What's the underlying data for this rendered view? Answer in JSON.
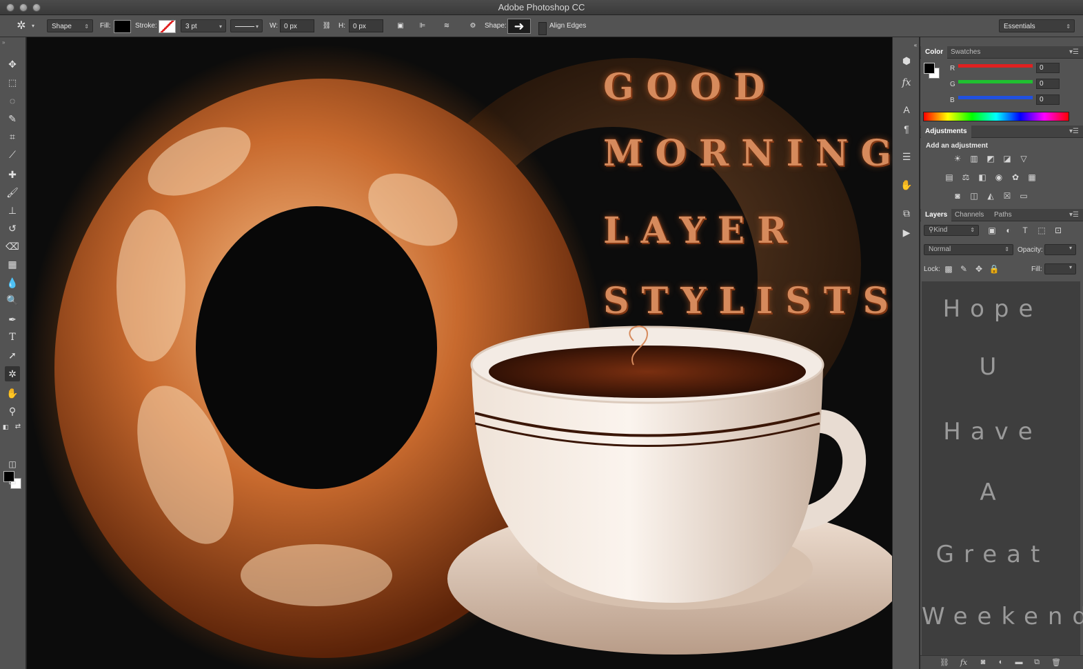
{
  "window": {
    "title": "Adobe Photoshop CC"
  },
  "options_bar": {
    "tool_mode": "Shape",
    "fill_label": "Fill:",
    "stroke_label": "Stroke:",
    "stroke_width": "3 pt",
    "w_label": "W:",
    "w_value": "0 px",
    "h_label": "H:",
    "h_value": "0 px",
    "shape_label": "Shape:",
    "align_edges_label": "Align Edges",
    "workspace": "Essentials"
  },
  "tools": [
    "move-tool",
    "marquee-tool",
    "lasso-tool",
    "quick-selection-tool",
    "crop-tool",
    "eyedropper-tool",
    "healing-brush-tool",
    "brush-tool",
    "clone-stamp-tool",
    "history-brush-tool",
    "eraser-tool",
    "gradient-tool",
    "blur-tool",
    "dodge-tool",
    "pen-tool",
    "type-tool",
    "path-selection-tool",
    "custom-shape-tool",
    "hand-tool",
    "zoom-tool"
  ],
  "canvas": {
    "headline": [
      "GOOD",
      "MORNING",
      "LAYER",
      "STYLISTS"
    ]
  },
  "color_panel": {
    "tabs": [
      "Color",
      "Swatches"
    ],
    "r_label": "R",
    "g_label": "G",
    "b_label": "B",
    "r_value": "0",
    "g_value": "0",
    "b_value": "0",
    "colors": {
      "red": "#e02020",
      "green": "#20c030",
      "blue": "#2050e0"
    }
  },
  "adjustments_panel": {
    "tab": "Adjustments",
    "heading": "Add an adjustment"
  },
  "layers_panel": {
    "tabs": [
      "Layers",
      "Channels",
      "Paths"
    ],
    "filter_kind": "Kind",
    "blend_mode": "Normal",
    "opacity_label": "Opacity:",
    "lock_label": "Lock:",
    "fill_label": "Fill:",
    "handwriting": [
      "Hope",
      "U",
      "Have",
      "A",
      "Great",
      "Weekend"
    ]
  }
}
